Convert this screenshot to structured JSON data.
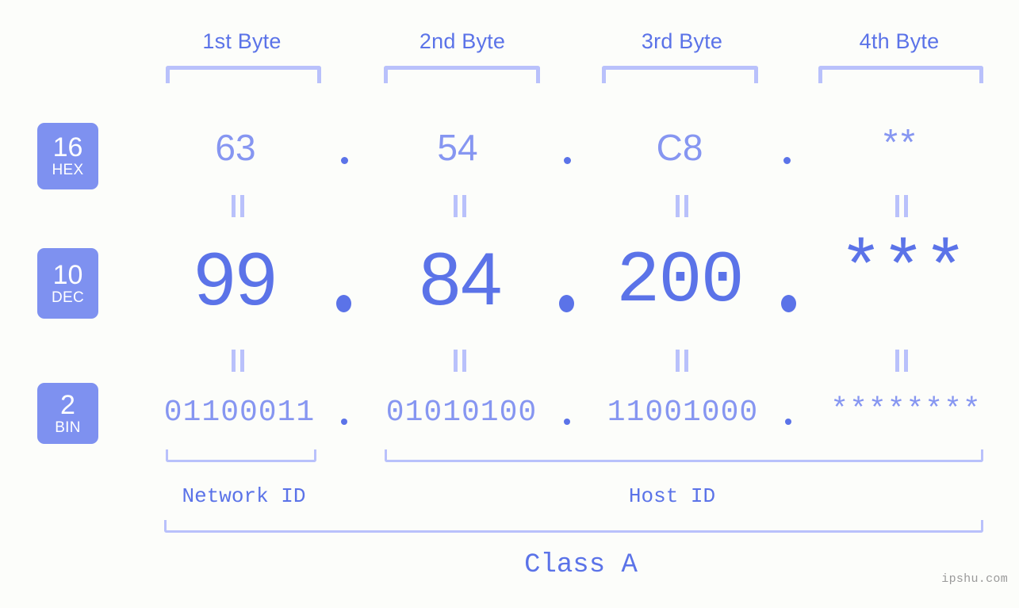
{
  "background_color": "#fcfdfa",
  "accent_color": "#5b73e8",
  "accent_light": "#8696f1",
  "bracket_color": "#b9c1fb",
  "badge_color": "#7e91f0",
  "headers": {
    "byte1": "1st Byte",
    "byte2": "2nd Byte",
    "byte3": "3rd Byte",
    "byte4": "4th Byte"
  },
  "bases": [
    {
      "number": "16",
      "name": "HEX"
    },
    {
      "number": "10",
      "name": "DEC"
    },
    {
      "number": "2",
      "name": "BIN"
    }
  ],
  "rows": {
    "hex": {
      "b1": "63",
      "b2": "54",
      "b3": "C8",
      "b4": "**"
    },
    "dec": {
      "b1": "99",
      "b2": "84",
      "b3": "200",
      "b4": "***"
    },
    "bin": {
      "b1": "01100011",
      "b2": "01010100",
      "b3": "11001000",
      "b4": "********"
    }
  },
  "separators": {
    "dot": ".",
    "equals": "="
  },
  "footer": {
    "network_id": "Network ID",
    "host_id": "Host ID",
    "class": "Class A"
  },
  "watermark": "ipshu.com"
}
